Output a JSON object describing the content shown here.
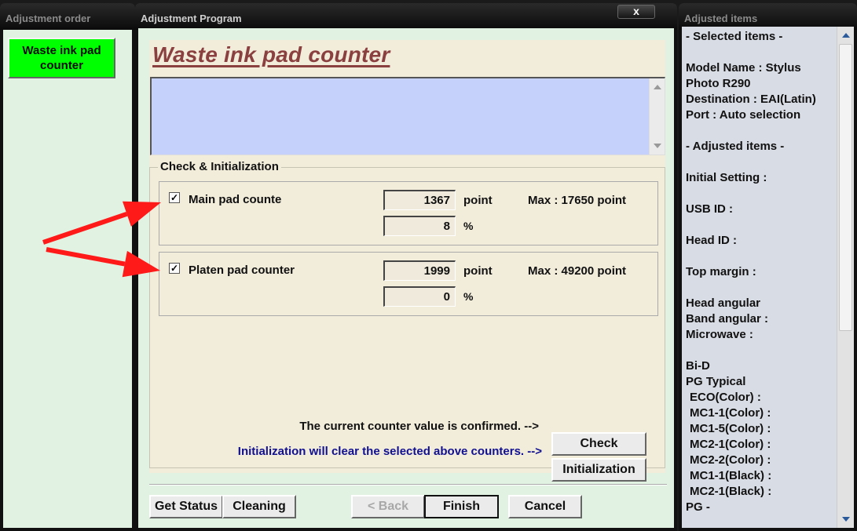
{
  "windows": {
    "order": {
      "title": "Adjustment order",
      "items": [
        {
          "label": "Waste ink pad counter",
          "color": "#00ff00"
        }
      ]
    },
    "program": {
      "title": "Adjustment Program",
      "close_label": "x",
      "heading": "Waste ink pad counter",
      "message_box": "",
      "group_title": "Check & Initialization",
      "counters": [
        {
          "label": "Main pad counte",
          "checked": true,
          "point_value": "1367",
          "point_unit": "point",
          "percent_value": "8",
          "percent_unit": "%",
          "max_text": "Max : 17650 point"
        },
        {
          "label": "Platen pad counter",
          "checked": true,
          "point_value": "1999",
          "point_unit": "point",
          "percent_value": "0",
          "percent_unit": "%",
          "max_text": "Max : 49200 point"
        }
      ],
      "confirm_text": "The current counter value is confirmed. -->",
      "init_text": "Initialization will clear the selected above counters. -->",
      "buttons": {
        "check": "Check",
        "initialization": "Initialization",
        "get_status": "Get Status",
        "cleaning": "Cleaning",
        "back": "< Back",
        "finish": "Finish",
        "cancel": "Cancel"
      }
    },
    "adjusted": {
      "title": "Adjusted items",
      "lines": [
        "- Selected items -",
        "",
        "Model Name : Stylus",
        "Photo R290",
        "Destination : EAI(Latin)",
        "Port : Auto selection",
        "",
        "- Adjusted items -",
        "",
        "Initial Setting :",
        "",
        "USB ID :",
        "",
        "Head ID :",
        "",
        "Top margin :",
        "",
        "Head angular",
        "Band angular :",
        "Microwave :",
        "",
        "Bi-D",
        "PG Typical",
        " ECO(Color)  :",
        " MC1-1(Color) :",
        " MC1-5(Color) :",
        " MC2-1(Color) :",
        " MC2-2(Color) :",
        " MC1-1(Black) :",
        " MC2-1(Black) :",
        "PG -"
      ]
    }
  },
  "annotation_color": "#ff1a1a"
}
